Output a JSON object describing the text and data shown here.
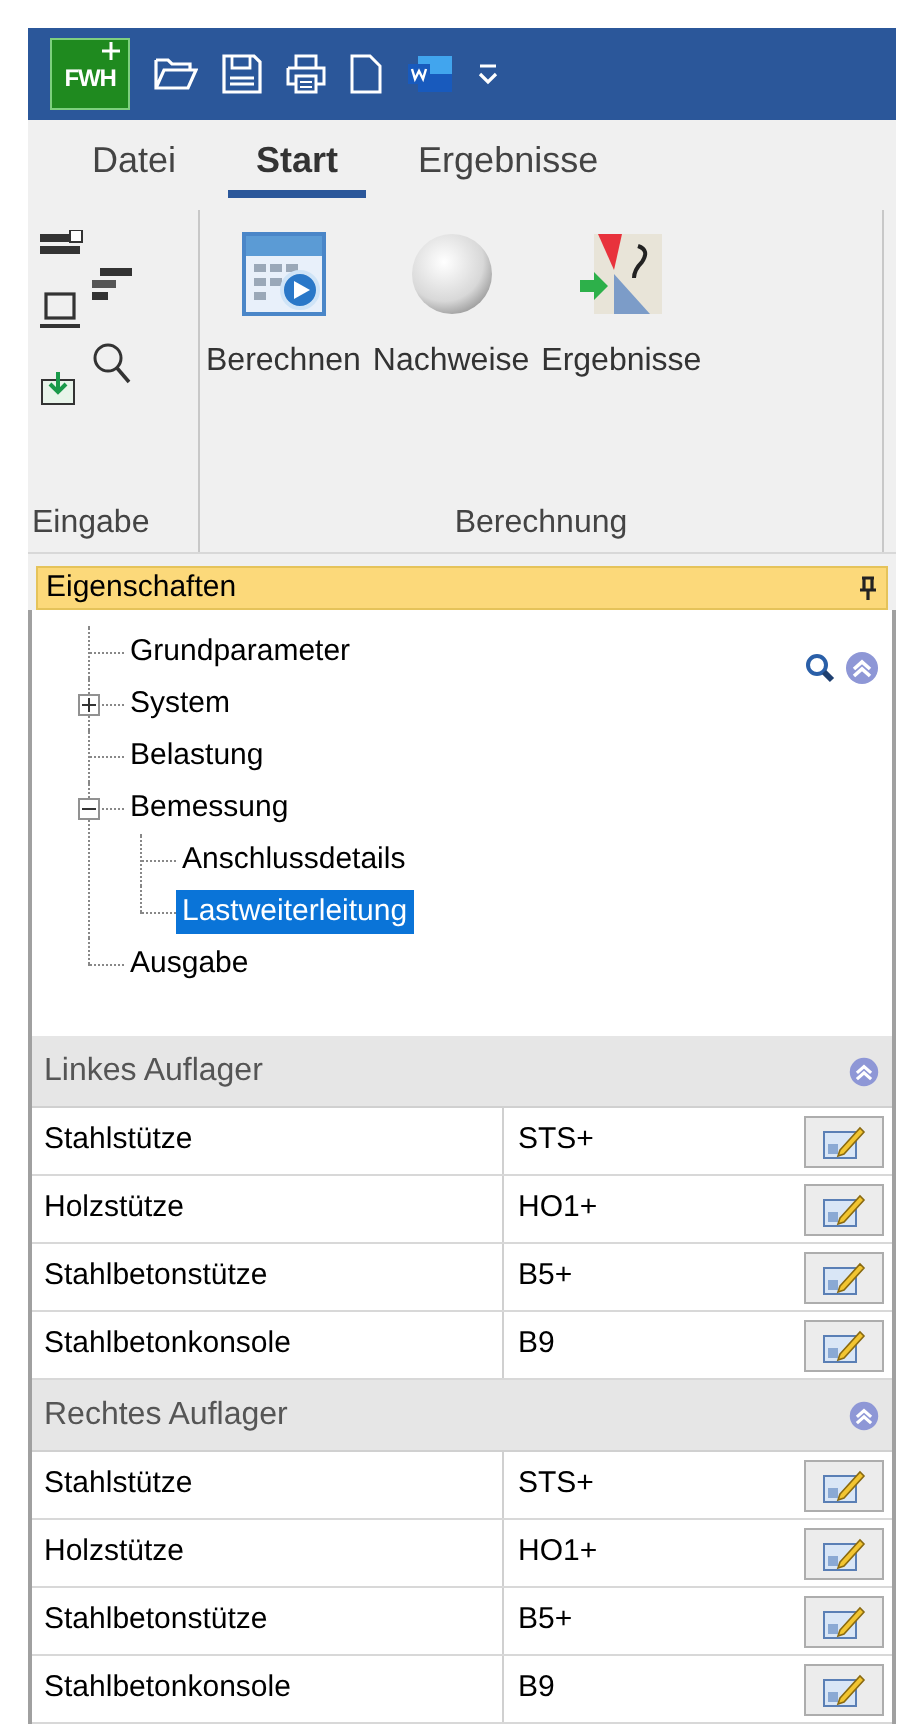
{
  "title_bar": {
    "logo": "FWH"
  },
  "tabs": [
    {
      "label": "Datei",
      "selected": false
    },
    {
      "label": "Start",
      "selected": true
    },
    {
      "label": "Ergebnisse",
      "selected": false
    }
  ],
  "ribbon": {
    "groups": [
      {
        "label": "Eingabe",
        "kind": "small"
      },
      {
        "label": "Berechnung",
        "kind": "large",
        "buttons": [
          {
            "label": "Berechnen",
            "kind": "calc"
          },
          {
            "label": "Nachweise",
            "kind": "sphere"
          },
          {
            "label": "Ergebnisse",
            "kind": "results"
          }
        ]
      }
    ]
  },
  "panel": {
    "title": "Eigenschaften",
    "tree": [
      {
        "label": "Grundparameter",
        "selected": false
      },
      {
        "label": "System",
        "selected": false,
        "expanded": false
      },
      {
        "label": "Belastung",
        "selected": false
      },
      {
        "label": "Bemessung",
        "selected": false,
        "expanded": true,
        "children": [
          {
            "label": "Anschlussdetails",
            "selected": false
          },
          {
            "label": "Lastweiterleitung",
            "selected": true
          }
        ]
      },
      {
        "label": "Ausgabe",
        "selected": false
      }
    ],
    "sections": [
      {
        "title": "Linkes Auflager",
        "rows": [
          {
            "name": "Stahlstütze",
            "value": "STS+"
          },
          {
            "name": "Holzstütze",
            "value": "HO1+"
          },
          {
            "name": "Stahlbetonstütze",
            "value": "B5+"
          },
          {
            "name": "Stahlbetonkonsole",
            "value": "B9"
          }
        ]
      },
      {
        "title": "Rechtes Auflager",
        "rows": [
          {
            "name": "Stahlstütze",
            "value": "STS+"
          },
          {
            "name": "Holzstütze",
            "value": "HO1+"
          },
          {
            "name": "Stahlbetonstütze",
            "value": "B5+"
          },
          {
            "name": "Stahlbetonkonsole",
            "value": "B9"
          }
        ]
      }
    ]
  }
}
